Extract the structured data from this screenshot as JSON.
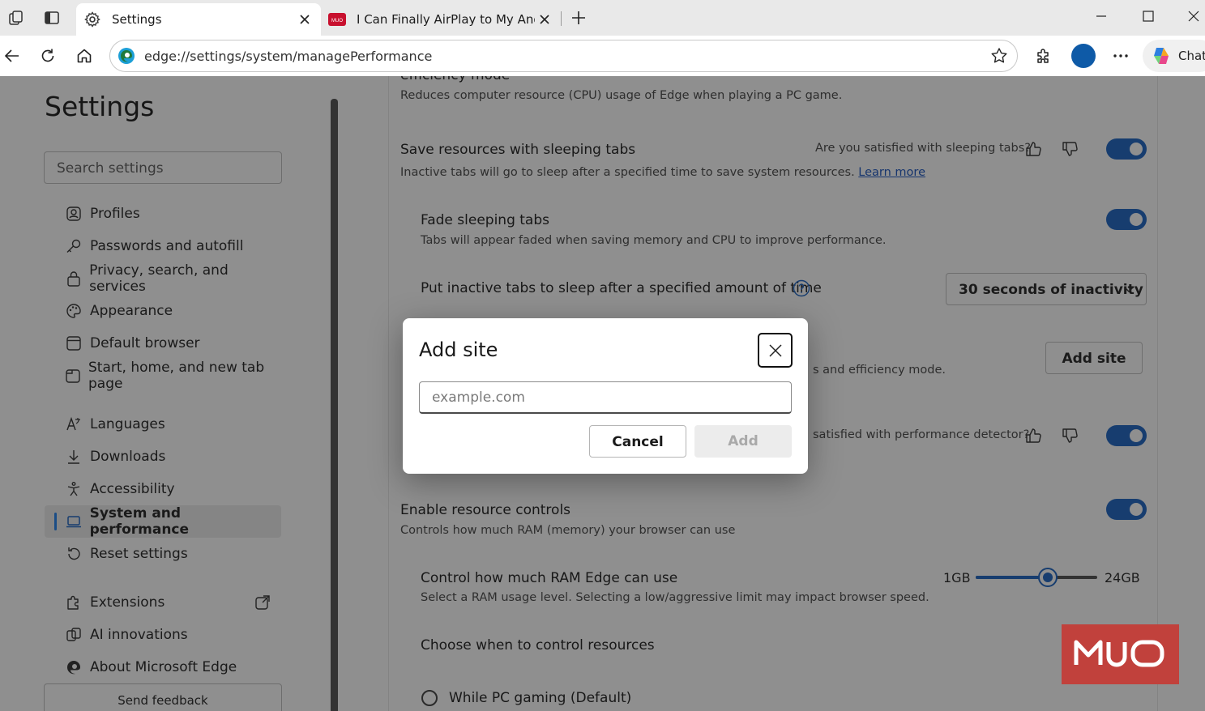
{
  "browser": {
    "tabs": [
      {
        "title": "Settings",
        "active": true,
        "icon": "gear-icon"
      },
      {
        "title": "I Can Finally AirPlay to My Androi",
        "active": false,
        "icon": "muo-favicon"
      }
    ],
    "address": {
      "url": "edge://settings/system/managePerformance"
    },
    "chat_label": "Chat"
  },
  "sidebar": {
    "title": "Settings",
    "search_placeholder": "Search settings",
    "items": [
      {
        "label": "Profiles",
        "icon": "profile-icon"
      },
      {
        "label": "Passwords and autofill",
        "icon": "key-icon"
      },
      {
        "label": "Privacy, search, and services",
        "icon": "lock-icon"
      },
      {
        "label": "Appearance",
        "icon": "palette-icon"
      },
      {
        "label": "Default browser",
        "icon": "browser-icon"
      },
      {
        "label": "Start, home, and new tab page",
        "icon": "home-tab-icon"
      },
      {
        "label": "Languages",
        "icon": "languages-icon"
      },
      {
        "label": "Downloads",
        "icon": "download-icon"
      },
      {
        "label": "Accessibility",
        "icon": "accessibility-icon"
      },
      {
        "label": "System and performance",
        "icon": "laptop-icon",
        "selected": true
      },
      {
        "label": "Reset settings",
        "icon": "reset-icon"
      },
      {
        "label": "Extensions",
        "icon": "puzzle-icon"
      },
      {
        "label": "AI innovations",
        "icon": "ai-icon"
      },
      {
        "label": "About Microsoft Edge",
        "icon": "edge-icon"
      }
    ],
    "send_feedback": "Send feedback"
  },
  "content": {
    "efficiency": {
      "title": "efficiency mode",
      "desc": "Reduces computer resource (CPU) usage of Edge when playing a PC game."
    },
    "sleeping_tabs": {
      "title": "Save resources with sleeping tabs",
      "question": "Are you satisfied with sleeping tabs?",
      "desc": "Inactive tabs will go to sleep after a specified time to save system resources.",
      "learn_more": "Learn more",
      "enabled": true
    },
    "fade_tabs": {
      "title": "Fade sleeping tabs",
      "desc": "Tabs will appear faded when saving memory and CPU to improve performance.",
      "enabled": true
    },
    "sleep_after": {
      "title": "Put inactive tabs to sleep after a specified amount of time",
      "value": "30 seconds of inactivity"
    },
    "never_sleep": {
      "desc_partial": "s and efficiency mode.",
      "button": "Add site"
    },
    "perf_detector": {
      "question_partial": "satisfied with performance detector?",
      "enabled": true
    },
    "resource_controls": {
      "title": "Enable resource controls",
      "desc": "Controls how much RAM (memory) your browser can use",
      "enabled": true
    },
    "ram": {
      "title": "Control how much RAM Edge can use",
      "desc": "Select a RAM usage level. Selecting a low/aggressive limit may impact browser speed.",
      "min": "1GB",
      "max": "24GB",
      "level": 0.59
    },
    "choose_when": {
      "title": "Choose when to control resources",
      "option": "While PC gaming (Default)"
    }
  },
  "modal": {
    "title": "Add site",
    "placeholder": "example.com",
    "value": "",
    "cancel": "Cancel",
    "add": "Add"
  },
  "watermark": "MUO",
  "colors": {
    "accent": "#173d6f",
    "muo_red": "#c1413c"
  }
}
